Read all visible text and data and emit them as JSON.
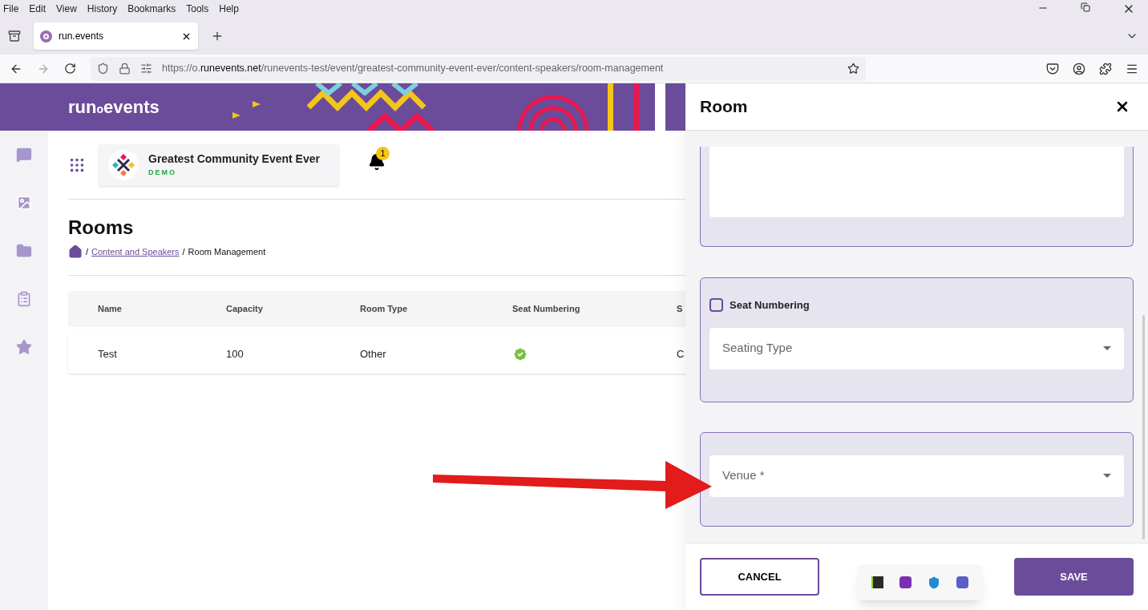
{
  "menu": [
    "File",
    "Edit",
    "View",
    "History",
    "Bookmarks",
    "Tools",
    "Help"
  ],
  "tabs": [
    {
      "label": "run.events",
      "selected": true
    }
  ],
  "url": {
    "prefix": "https://o.",
    "domain": "runevents.net",
    "path": "/runevents-test/event/greatest-community-event-ever/content-speakers/room-management"
  },
  "banner": {
    "logo_left": "run",
    "logo_mid": "o",
    "logo_right": "events"
  },
  "event": {
    "name": "Greatest Community Event Ever",
    "badge": "DEMO",
    "notifications": "1"
  },
  "page": {
    "title": "Rooms",
    "separator": "/",
    "breadcrumb": [
      {
        "label": "Content and Speakers",
        "link": true
      },
      {
        "label": "Room Management",
        "link": false
      }
    ]
  },
  "table": {
    "columns": [
      "Name",
      "Capacity",
      "Room Type",
      "Seat Numbering",
      "S"
    ],
    "rows": [
      {
        "name": "Test",
        "capacity": "100",
        "room_type": "Other",
        "seat_numbering": true,
        "column_5": "C"
      }
    ]
  },
  "drawer": {
    "title": "Room",
    "sections": [
      {
        "kind": "textarea"
      },
      {
        "kind": "checkbox-select",
        "checkbox": {
          "label": "Seat Numbering",
          "checked": false
        },
        "select": {
          "placeholder": "Seating Type"
        }
      },
      {
        "kind": "select",
        "select": {
          "placeholder": "Venue *"
        }
      }
    ],
    "buttons": [
      {
        "label": "CANCEL",
        "kind": "secondary"
      },
      {
        "label": "SAVE",
        "kind": "primary"
      }
    ]
  }
}
